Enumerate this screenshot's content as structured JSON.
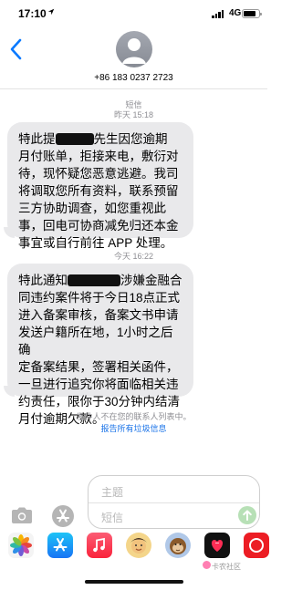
{
  "status_bar": {
    "time": "17:10",
    "network": "4G",
    "battery_level": 0.8,
    "icons": [
      "location-icon",
      "signal-icon",
      "battery-icon"
    ]
  },
  "header": {
    "back_icon": "chevron-left-icon",
    "avatar_icon": "person-icon",
    "contact_number": "+86 183 0237 2723"
  },
  "conversation": {
    "channel_label": "短信",
    "messages": [
      {
        "timestamp": "昨天 15:18",
        "lines": [
          {
            "before": "特此提",
            "redacted": true,
            "after": "先生因您逾期"
          },
          {
            "text": "月付账单，拒接来电，敷衍对"
          },
          {
            "text": "待，现怀疑您恶意逃避。我司"
          },
          {
            "text": "将调取您所有资料，联系预留"
          },
          {
            "text": "三方协助调查，如您重视此"
          },
          {
            "text": "事，回电可协商减免归还本金"
          },
          {
            "text": "事宜或自行前往 APP 处理。"
          }
        ]
      },
      {
        "timestamp": "今天 16:22",
        "lines": [
          {
            "before": "特此通知",
            "redacted": true,
            "after": "涉嫌金融合"
          },
          {
            "text": "同违约案件将于今日18点正式"
          },
          {
            "text": "进入备案审核，备案文书申请"
          },
          {
            "text": "发送户籍所在地，1小时之后确"
          },
          {
            "text": "定备案结果，签署相关函件，"
          },
          {
            "text": "一旦进行追究你将面临相关违"
          },
          {
            "text": "约责任，限你于30分钟内结清"
          },
          {
            "text": "月付逾期欠款。"
          }
        ]
      }
    ],
    "sender_notice": "发件人不在您的联系人列表中。",
    "report_link": "报告所有垃圾信息"
  },
  "compose": {
    "camera_icon": "camera-icon",
    "apps_icon": "app-store-icon",
    "subject_placeholder": "主题",
    "message_placeholder": "短信",
    "send_icon": "send-arrow-icon"
  },
  "app_drawer": {
    "apps": [
      "photos-icon",
      "app-store-icon",
      "music-icon",
      "memoji-icon",
      "animoji-icon",
      "digital-touch-icon",
      "heart-sticker-icon",
      "more-app-icon"
    ]
  },
  "watermark": "卡农社区"
}
